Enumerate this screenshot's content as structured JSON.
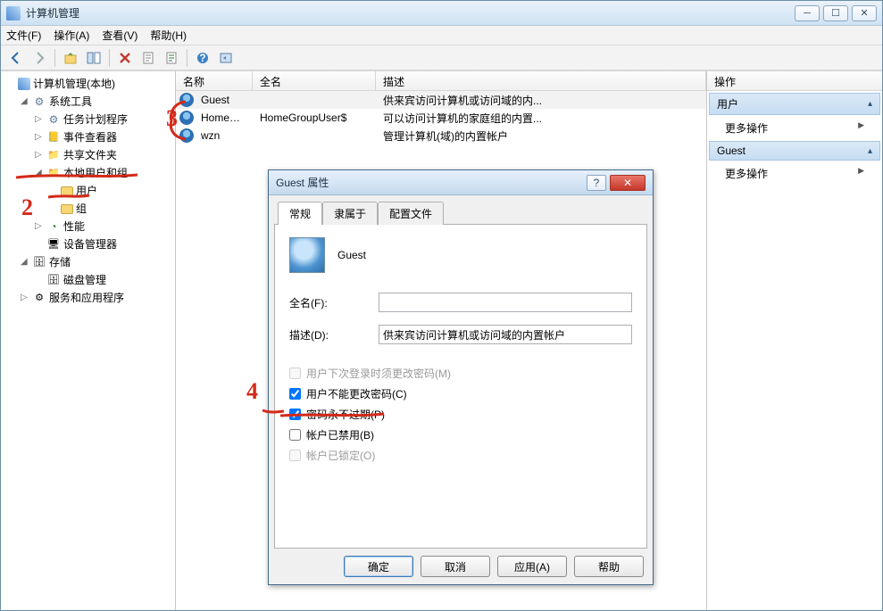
{
  "window": {
    "title": "计算机管理"
  },
  "menu": {
    "file": "文件(F)",
    "action": "操作(A)",
    "view": "查看(V)",
    "help": "帮助(H)"
  },
  "tree": {
    "root": "计算机管理(本地)",
    "system_tools": "系统工具",
    "task_scheduler": "任务计划程序",
    "event_viewer": "事件查看器",
    "shared_folders": "共享文件夹",
    "local_users_groups": "本地用户和组",
    "users": "用户",
    "groups": "组",
    "performance": "性能",
    "device_manager": "设备管理器",
    "storage": "存储",
    "disk_mgmt": "磁盘管理",
    "services_apps": "服务和应用程序"
  },
  "columns": {
    "name": "名称",
    "fullname": "全名",
    "description": "描述"
  },
  "users": [
    {
      "name": "Guest",
      "fullname": "",
      "description": "供来宾访问计算机或访问域的内..."
    },
    {
      "name": "HomeGrou...",
      "fullname": "HomeGroupUser$",
      "description": "可以访问计算机的家庭组的内置..."
    },
    {
      "name": "wzn",
      "fullname": "",
      "description": "管理计算机(域)的内置帐户"
    }
  ],
  "actions": {
    "header": "操作",
    "cat1": "用户",
    "cat2": "Guest",
    "more": "更多操作"
  },
  "dialog": {
    "title": "Guest 属性",
    "tabs": {
      "general": "常规",
      "memberof": "隶属于",
      "profile": "配置文件"
    },
    "name": "Guest",
    "fullname_label": "全名(F):",
    "fullname_value": "",
    "description_label": "描述(D):",
    "description_value": "供来宾访问计算机或访问域的内置帐户",
    "chk_changepw": "用户下次登录时须更改密码(M)",
    "chk_cannotchange": "用户不能更改密码(C)",
    "chk_neverexpire": "密码永不过期(P)",
    "chk_disabled": "帐户已禁用(B)",
    "chk_locked": "帐户已锁定(O)",
    "btn_ok": "确定",
    "btn_cancel": "取消",
    "btn_apply": "应用(A)",
    "btn_help": "帮助"
  },
  "annotations": {
    "n2": "2",
    "n3": "3",
    "n4": "4"
  }
}
